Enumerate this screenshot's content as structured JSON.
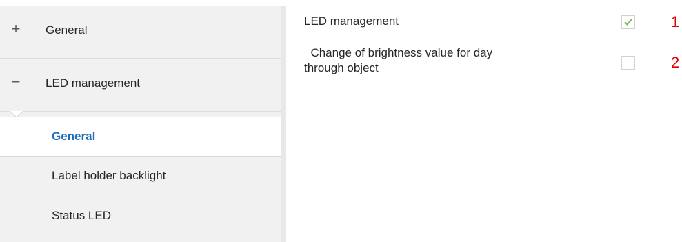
{
  "sidebar": {
    "groups": [
      {
        "label": "General",
        "toggle_symbol": "+",
        "icon": "plus-icon",
        "expanded": false
      },
      {
        "label": "LED management",
        "toggle_symbol": "−",
        "icon": "minus-icon",
        "expanded": true
      }
    ],
    "sub_items": [
      {
        "label": "General",
        "selected": true
      },
      {
        "label": "Label holder backlight",
        "selected": false
      },
      {
        "label": "Status LED",
        "selected": false
      }
    ]
  },
  "main": {
    "params": [
      {
        "label": "LED management",
        "checked": true,
        "annotation": "1"
      },
      {
        "label_line1": "  Change of brightness value for day",
        "label_line2": "through object",
        "checked": false,
        "annotation": "2"
      }
    ]
  },
  "colors": {
    "selected_text": "#1e6fb8",
    "check_mark": "#7dba54",
    "annotation": "#e00000",
    "sidebar_bg": "#f1f1f1"
  }
}
